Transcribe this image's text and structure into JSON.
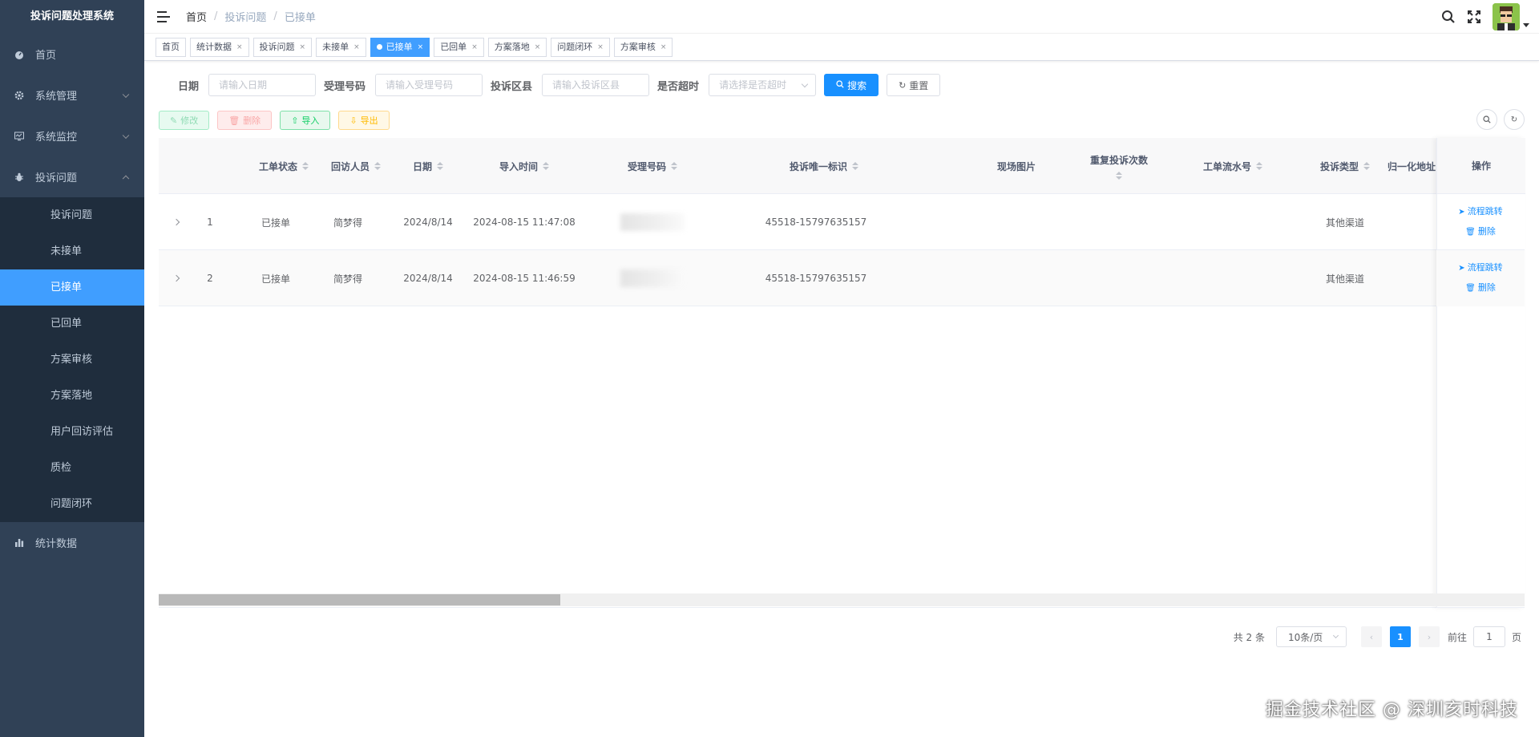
{
  "app": {
    "title": "投诉问题处理系统"
  },
  "sidebar": {
    "items": [
      {
        "label": "首页",
        "icon": "dashboard-icon"
      },
      {
        "label": "系统管理",
        "icon": "gear-icon"
      },
      {
        "label": "系统监控",
        "icon": "monitor-icon"
      },
      {
        "label": "投诉问题",
        "icon": "bug-icon"
      },
      {
        "label": "统计数据",
        "icon": "chart-icon"
      }
    ],
    "submenu": [
      "投诉问题",
      "未接单",
      "已接单",
      "已回单",
      "方案审核",
      "方案落地",
      "用户回访评估",
      "质检",
      "问题闭环"
    ],
    "active_sub": "已接单"
  },
  "header": {
    "breadcrumb": [
      "首页",
      "投诉问题",
      "已接单"
    ]
  },
  "tags": [
    "首页",
    "统计数据",
    "投诉问题",
    "未接单",
    "已接单",
    "已回单",
    "方案落地",
    "问题闭环",
    "方案审核"
  ],
  "search": {
    "date_label": "日期",
    "date_placeholder": "请输入日期",
    "code_label": "受理号码",
    "code_placeholder": "请输入受理号码",
    "district_label": "投诉区县",
    "district_placeholder": "请输入投诉区县",
    "timeout_label": "是否超时",
    "timeout_placeholder": "请选择是否超时",
    "search_btn": "搜索",
    "reset_btn": "重置"
  },
  "toolbar": {
    "edit": "修改",
    "delete": "删除",
    "import": "导入",
    "export": "导出"
  },
  "table": {
    "headers": {
      "status": "工单状态",
      "visitor": "回访人员",
      "date": "日期",
      "import_time": "导入时间",
      "code": "受理号码",
      "uid": "投诉唯一标识",
      "photo": "现场图片",
      "repeat": "重复投诉次数",
      "flow_no": "工单流水号",
      "type": "投诉类型",
      "address": "归一化地址",
      "ops": "操作"
    },
    "rows": [
      {
        "idx": "1",
        "status": "已接单",
        "visitor": "简梦得",
        "date": "2024/8/14",
        "import_time": "2024-08-15 11:47:08",
        "uid": "45518-15797635157",
        "type": "其他渠道"
      },
      {
        "idx": "2",
        "status": "已接单",
        "visitor": "简梦得",
        "date": "2024/8/14",
        "import_time": "2024-08-15 11:46:59",
        "uid": "45518-15797635157",
        "type": "其他渠道"
      }
    ],
    "op_flow": "流程跳转",
    "op_delete": "删除"
  },
  "pagination": {
    "total": "共 2 条",
    "page_size": "10条/页",
    "current_page": "1",
    "goto_label": "前往",
    "goto_value": "1",
    "page_suffix": "页"
  },
  "watermark": "掘金技术社区 @ 深圳亥时科技",
  "colors": {
    "sidebar_bg": "#304156",
    "submenu_bg": "#1f2d3d",
    "accent": "#409eff",
    "primary": "#1890ff"
  }
}
